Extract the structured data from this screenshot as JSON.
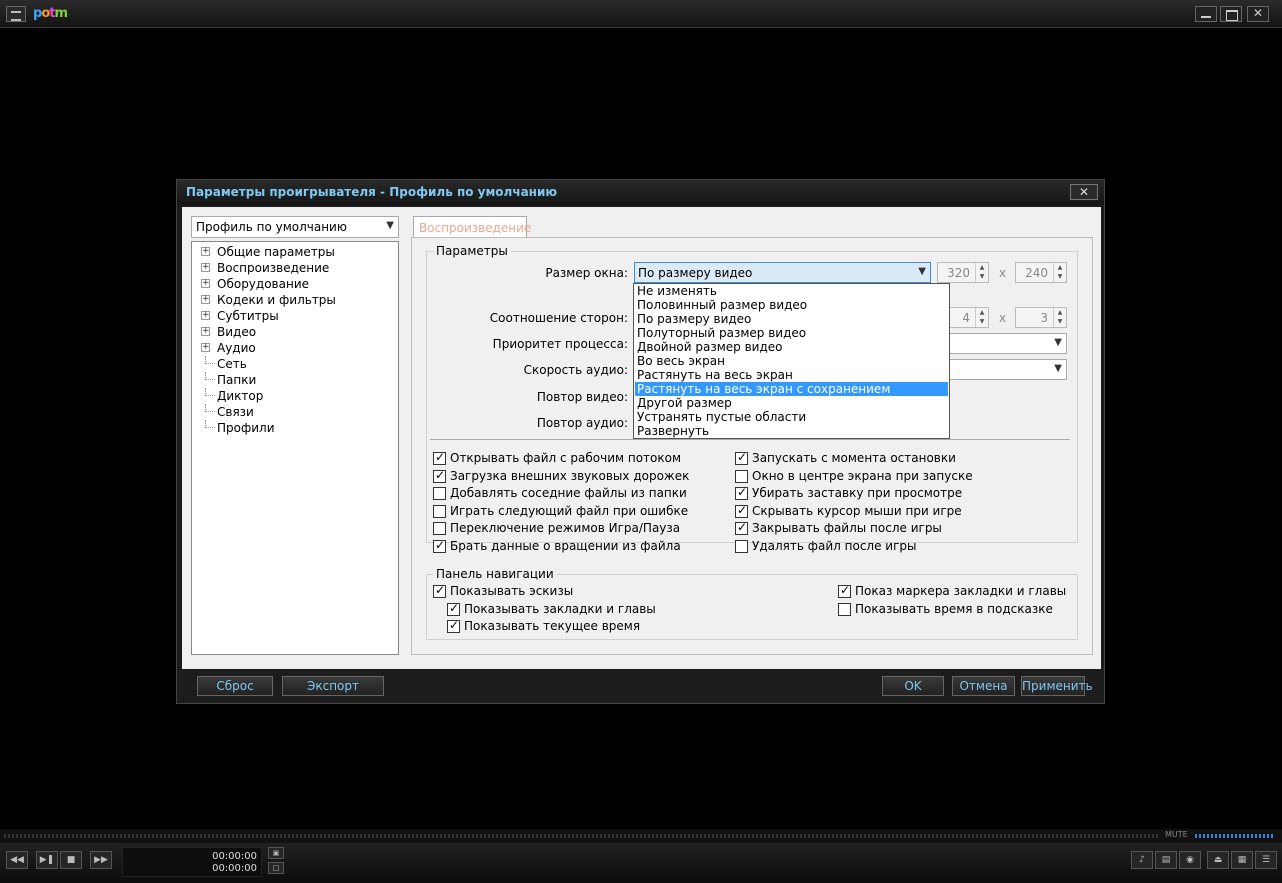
{
  "player": {
    "logo": [
      "p",
      "o",
      "t",
      "m"
    ]
  },
  "dialog": {
    "title": "Параметры проигрывателя - Профиль по умолчанию",
    "close_glyph": "✕",
    "profile_select": "Профиль по умолчанию",
    "tree": [
      {
        "label": "Общие параметры",
        "expandable": true
      },
      {
        "label": "Воспроизведение",
        "expandable": true
      },
      {
        "label": "Оборудование",
        "expandable": true
      },
      {
        "label": "Кодеки и фильтры",
        "expandable": true
      },
      {
        "label": "Субтитры",
        "expandable": true
      },
      {
        "label": "Видео",
        "expandable": true
      },
      {
        "label": "Аудио",
        "expandable": true
      },
      {
        "label": "Сеть",
        "expandable": false
      },
      {
        "label": "Папки",
        "expandable": false
      },
      {
        "label": "Диктор",
        "expandable": false
      },
      {
        "label": "Связи",
        "expandable": false
      },
      {
        "label": "Профили",
        "expandable": false
      }
    ],
    "tab": "Воспроизведение",
    "params": {
      "title": "Параметры",
      "window_size_label": "Размер окна:",
      "window_size_value": "По размеру видео",
      "width": "320",
      "height": "240",
      "aspect_label": "Соотношение сторон:",
      "aspect_w": "4",
      "aspect_h": "3",
      "priority_label": "Приоритет процесса:",
      "audio_speed_label": "Скорость аудио:",
      "video_repeat_label": "Повтор видео:",
      "audio_repeat_label": "Повтор аудио:",
      "x_sep": "x",
      "dropdown": [
        "Не изменять",
        "Половинный размер видео",
        "По размеру видео",
        "Полуторный размер видео",
        "Двойной размер видео",
        "Во весь экран",
        "Растянуть на весь экран",
        "Растянуть на весь экран с сохранением пропорций",
        "Другой размер",
        "Устранять пустые области",
        "Развернуть"
      ],
      "dropdown_selected": 7,
      "checks_left": [
        {
          "label": "Открывать файл с рабочим потоком",
          "checked": true
        },
        {
          "label": "Загрузка внешних звуковых дорожек",
          "checked": true
        },
        {
          "label": "Добавлять соседние файлы из папки",
          "checked": false
        },
        {
          "label": "Играть следующий файл при ошибке",
          "checked": false
        },
        {
          "label": "Переключение режимов Игра/Пауза",
          "checked": false
        },
        {
          "label": "Брать данные о вращении из файла",
          "checked": true
        }
      ],
      "checks_right": [
        {
          "label": "Запускать с момента остановки",
          "checked": true
        },
        {
          "label": "Окно в центре экрана при запуске",
          "checked": false
        },
        {
          "label": "Убирать заставку при просмотре",
          "checked": true
        },
        {
          "label": "Скрывать курсор мыши при игре",
          "checked": true
        },
        {
          "label": "Закрывать файлы после игры",
          "checked": true
        },
        {
          "label": "Удалять файл после игры",
          "checked": false
        }
      ]
    },
    "nav_panel": {
      "title": "Панель навигации",
      "checks": [
        {
          "label": "Показывать эскизы",
          "checked": true
        },
        {
          "label": "Показывать закладки и главы",
          "checked": true
        },
        {
          "label": "Показывать текущее время",
          "checked": true
        },
        {
          "label": "Показ маркера закладки и главы",
          "checked": true
        },
        {
          "label": "Показывать время в подсказке",
          "checked": false
        }
      ]
    },
    "buttons": {
      "reset": "Сброс",
      "export": "Экспорт",
      "ok": "OK",
      "cancel": "Отмена",
      "apply": "Применить"
    }
  },
  "controls": {
    "mute_label": "MUTE",
    "time_current": "00:00:00",
    "time_total": "00:00:00"
  }
}
